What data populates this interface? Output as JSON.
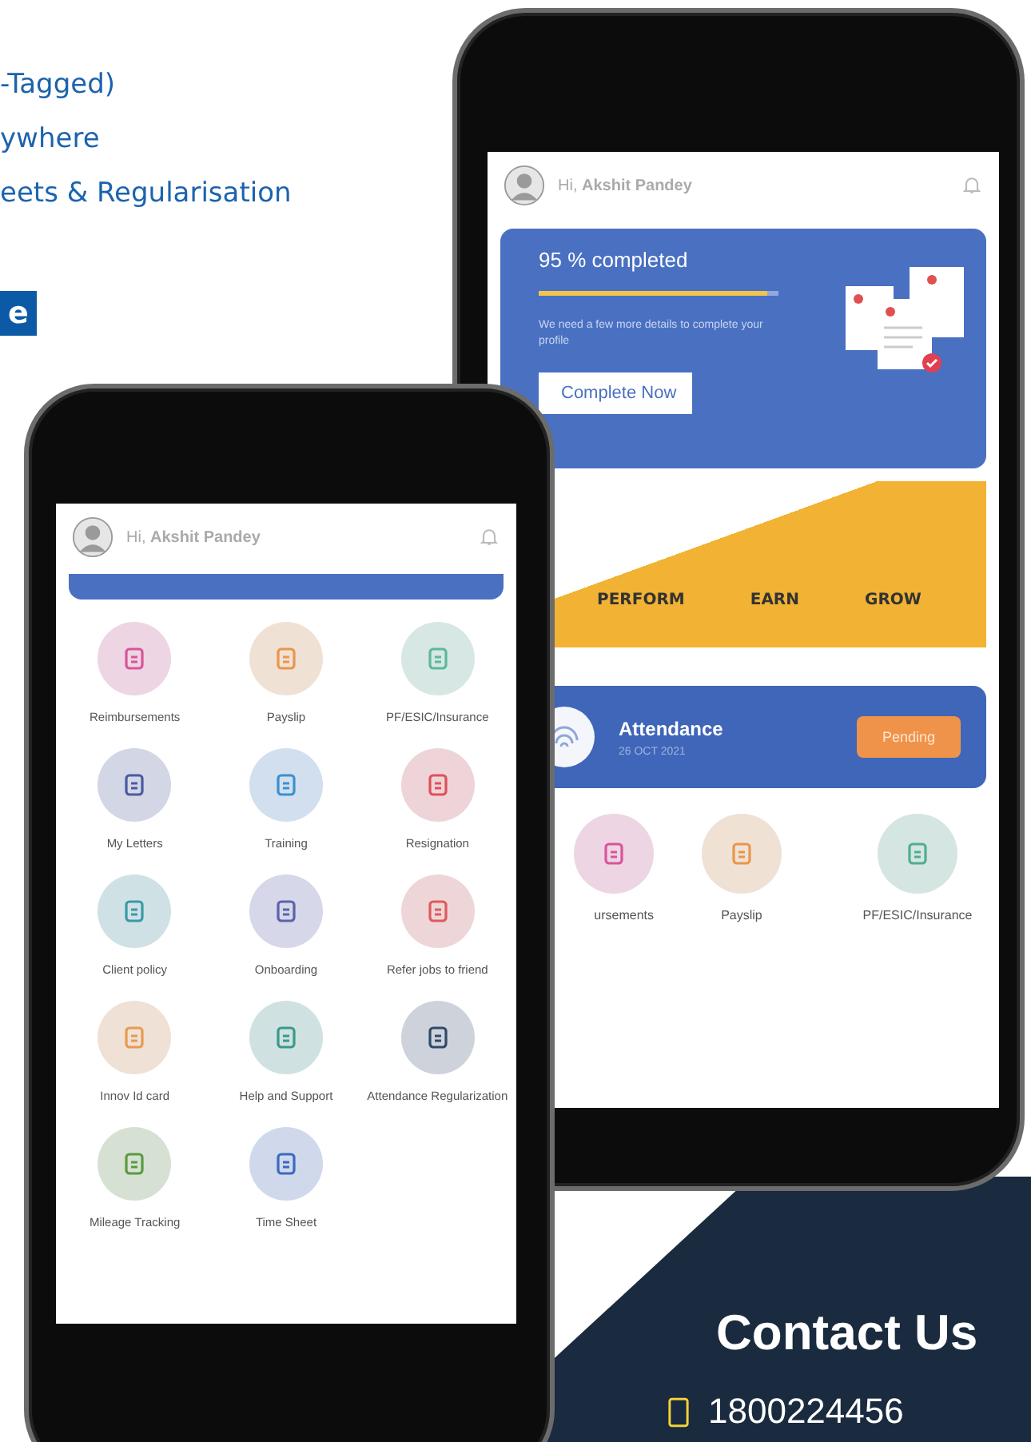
{
  "intro": {
    "lines": [
      "-Tagged)",
      "ywhere",
      "eets & Regularisation"
    ],
    "button": "e"
  },
  "back_phone": {
    "header": {
      "greeting": "Hi, **Akshit Pandey**"
    },
    "profile_card": {
      "title": "95 % completed",
      "level": 0.95,
      "subtitle": "We need a few more details to complete your profile",
      "button": "Complete Now"
    },
    "banner": {
      "words": [
        "PERFORM",
        "EARN",
        "GROW"
      ]
    },
    "attendance": {
      "title": "Attendance",
      "date": "26 OCT 2021",
      "status": "Pending"
    },
    "tiles": [
      {
        "label": "ursements",
        "color": "#d9559a"
      },
      {
        "label": "Payslip",
        "color": "#e9964a"
      },
      {
        "label": "PF/ESIC/Insurance",
        "color": "#4fae8e"
      }
    ]
  },
  "front_phone": {
    "header": {
      "greeting": "Hi, **Akshit Pandey**"
    },
    "tiles": [
      {
        "label": "Reimbursements",
        "color": "#d9559a"
      },
      {
        "label": "Payslip",
        "color": "#e9964a"
      },
      {
        "label": "PF/ESIC/Insurance",
        "color": "#5cb89b"
      },
      {
        "label": "My Letters",
        "color": "#4a5aa0"
      },
      {
        "label": "Training",
        "color": "#3d8fd0"
      },
      {
        "label": "Resignation",
        "color": "#e0505a"
      },
      {
        "label": "Client policy",
        "color": "#3a9aa8"
      },
      {
        "label": "Onboarding",
        "color": "#5a62b0"
      },
      {
        "label": "Refer jobs to friend",
        "color": "#e05a5a"
      },
      {
        "label": "Innov Id card",
        "color": "#e89a50"
      },
      {
        "label": "Help and Support",
        "color": "#3a9a8a"
      },
      {
        "label": "Attendance Regularization",
        "color": "#2f4a6a"
      },
      {
        "label": "Mileage Tracking",
        "color": "#5a9a40"
      },
      {
        "label": "Time Sheet",
        "color": "#3a6ac0"
      }
    ]
  },
  "contact": {
    "title": "Contact Us",
    "phone": "1800224456"
  }
}
